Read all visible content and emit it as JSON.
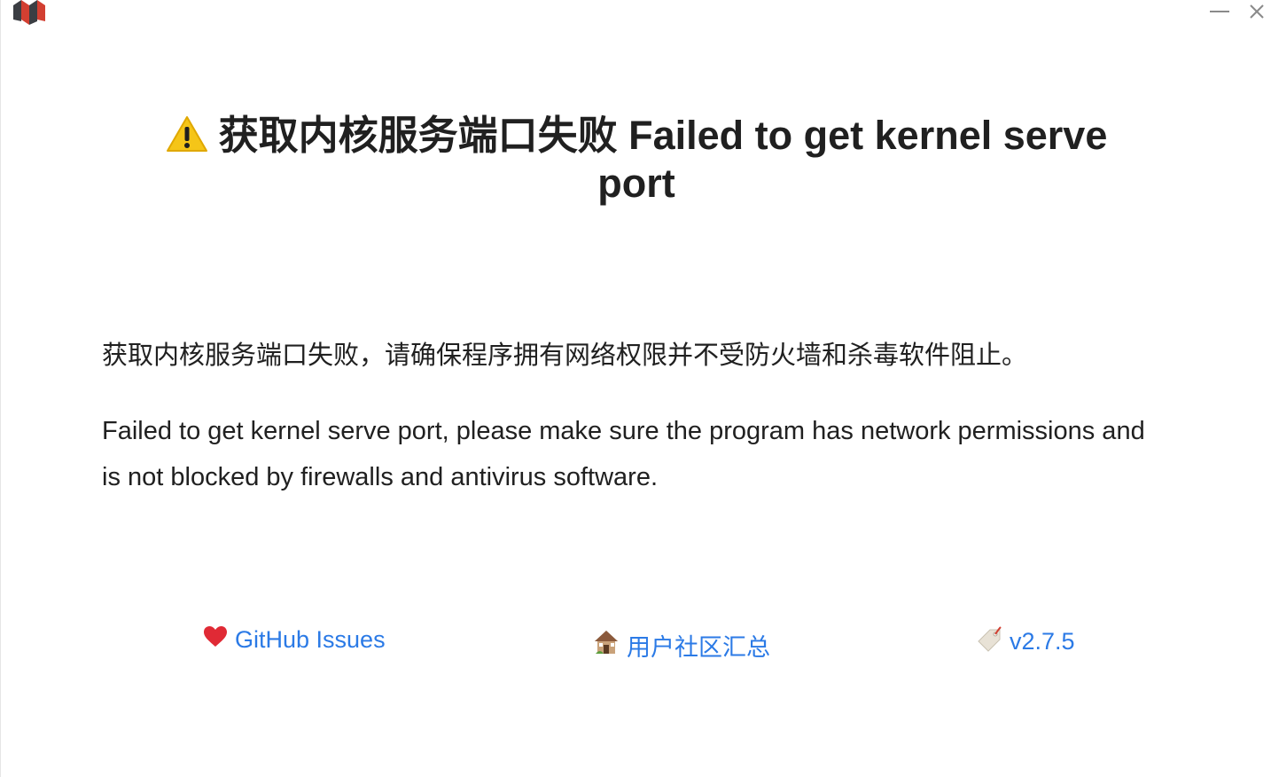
{
  "window": {
    "logo_icon": "siyuan-logo-icon",
    "minimize_icon": "minimize-icon",
    "close_icon": "close-icon"
  },
  "title": {
    "icon": "warning-icon",
    "line1": "获取内核服务端口失败 Failed to get kernel serve",
    "line2": "port"
  },
  "message": {
    "zh": "获取内核服务端口失败，请确保程序拥有网络权限并不受防火墙和杀毒软件阻止。",
    "en": "Failed to get kernel serve port, please make sure the program has network permissions and is not blocked by firewalls and antivirus software."
  },
  "links": {
    "github": {
      "icon": "heart-icon",
      "label": "GitHub Issues"
    },
    "community": {
      "icon": "house-icon",
      "label": "用户社区汇总"
    },
    "version": {
      "icon": "tag-icon",
      "label": "v2.7.5"
    }
  },
  "colors": {
    "link": "#2b7ae6",
    "text": "#202020",
    "logo_red": "#d23f31",
    "logo_dark": "#3b3e43",
    "warning": "#f5c518"
  }
}
